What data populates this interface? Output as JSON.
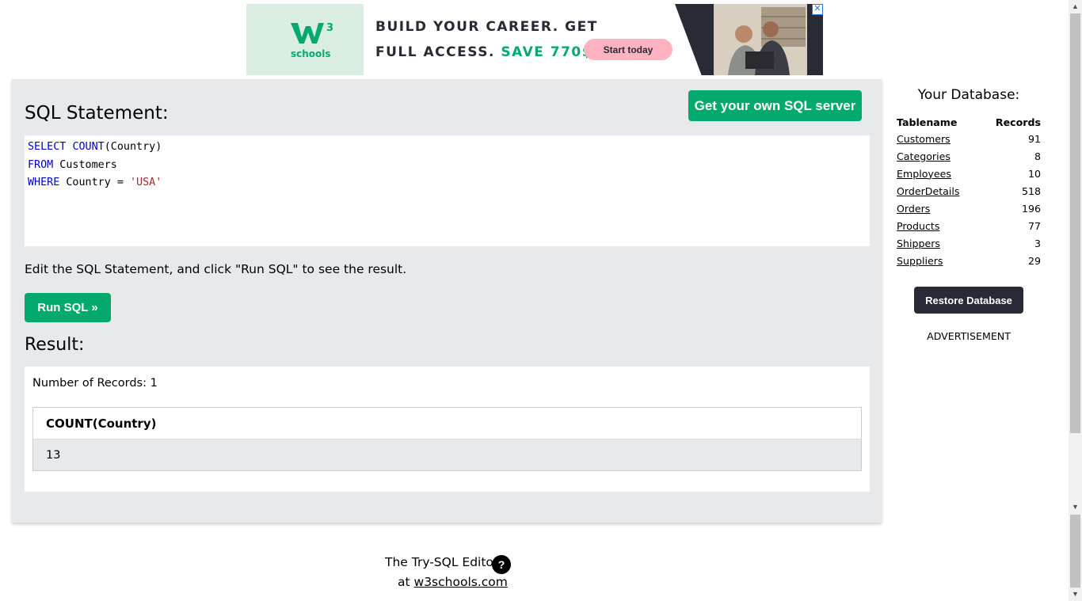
{
  "ad": {
    "logo_text": "schools",
    "logo_superscript": "3",
    "line1": "BUILD YOUR CAREER. GET",
    "line2_prefix": "FULL ACCESS.",
    "line2_highlight": "SAVE 770$",
    "cta": "Start today",
    "close_glyph": "✕"
  },
  "editor": {
    "heading": "SQL Statement:",
    "own_server_button": "Get your own SQL server",
    "code": [
      {
        "kw1": "SELECT",
        "kw2": "COUNT",
        "rest": "(Country)"
      },
      {
        "kw1": "FROM",
        "rest": " Customers"
      },
      {
        "kw1": "WHERE",
        "rest": " Country = ",
        "str": "'USA'"
      }
    ],
    "instruction": "Edit the SQL Statement, and click \"Run SQL\" to see the result.",
    "run_button": "Run SQL »"
  },
  "result": {
    "heading": "Result:",
    "records_label": "Number of Records: 1",
    "column": "COUNT(Country)",
    "value": "13"
  },
  "sidebar": {
    "title": "Your Database:",
    "col_name": "Tablename",
    "col_records": "Records",
    "tables": [
      {
        "name": "Customers",
        "records": "91"
      },
      {
        "name": "Categories",
        "records": "8"
      },
      {
        "name": "Employees",
        "records": "10"
      },
      {
        "name": "OrderDetails",
        "records": "518"
      },
      {
        "name": "Orders",
        "records": "196"
      },
      {
        "name": "Products",
        "records": "77"
      },
      {
        "name": "Shippers",
        "records": "3"
      },
      {
        "name": "Suppliers",
        "records": "29"
      }
    ],
    "restore_button": "Restore Database",
    "advertisement": "ADVERTISEMENT"
  },
  "footer": {
    "line1": "The Try-SQL Editor",
    "help_glyph": "?",
    "at": "at",
    "link": "w3schools.com"
  },
  "colors": {
    "accent_green": "#04aa6d",
    "dark": "#282a35",
    "panel_bg": "#e7e9eb"
  }
}
